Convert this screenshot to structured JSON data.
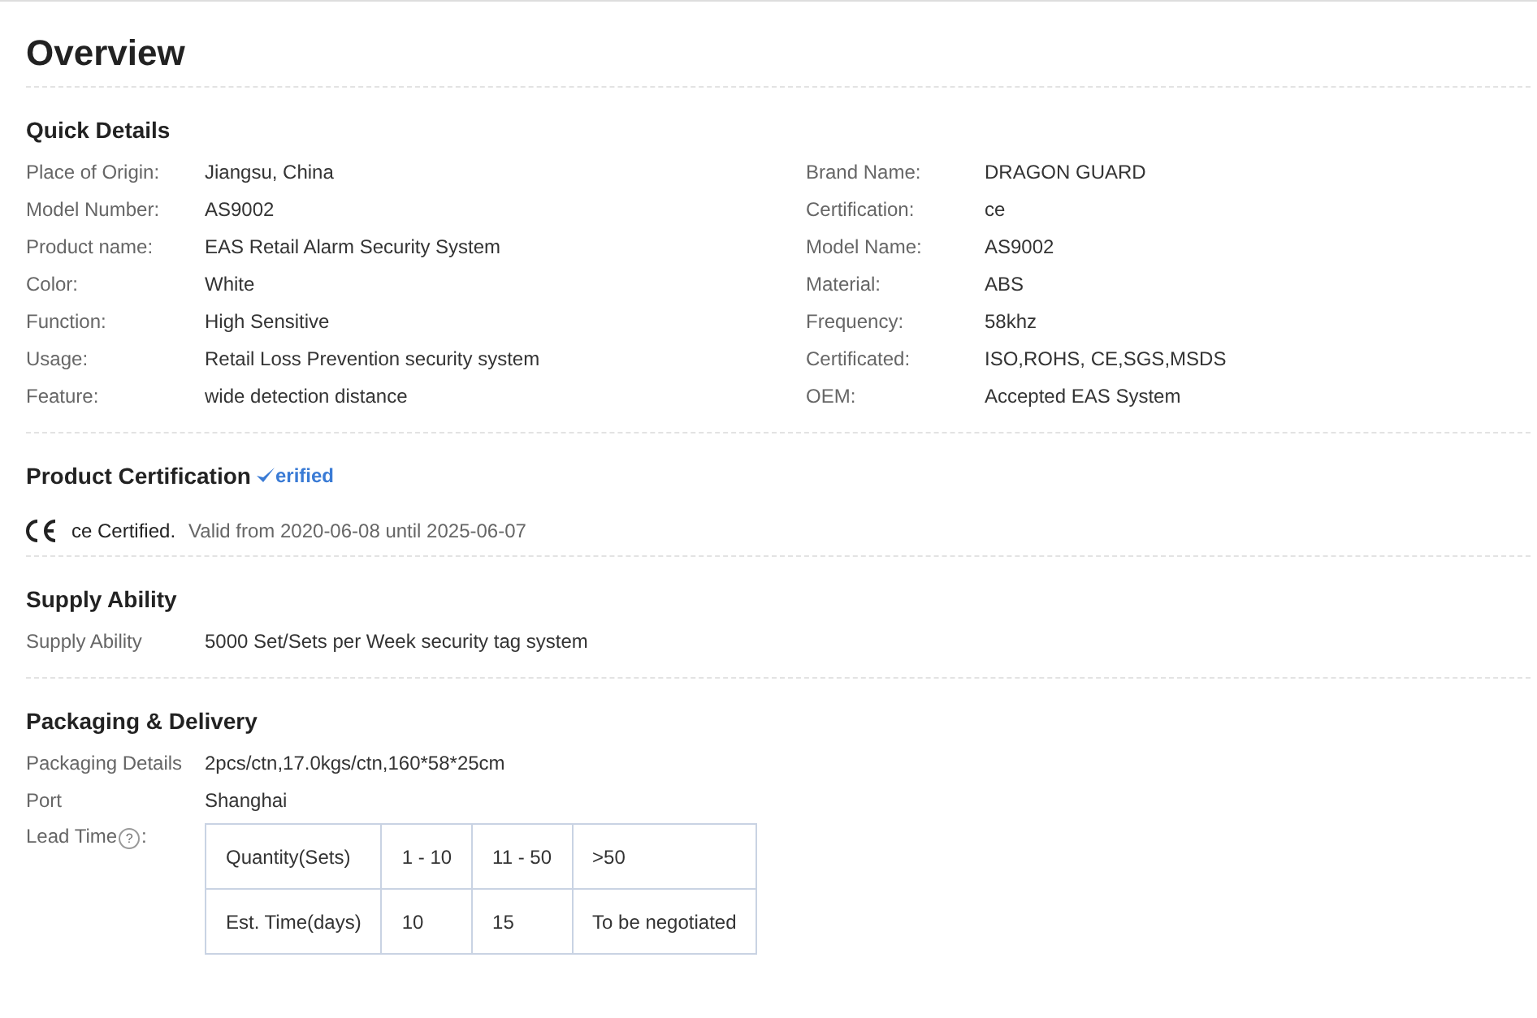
{
  "title": "Overview",
  "quick_details": {
    "heading": "Quick Details",
    "rows": [
      {
        "left_label": "Place of Origin:",
        "left_value": "Jiangsu, China",
        "right_label": "Brand Name:",
        "right_value": "DRAGON GUARD"
      },
      {
        "left_label": "Model Number:",
        "left_value": "AS9002",
        "right_label": "Certification:",
        "right_value": "ce"
      },
      {
        "left_label": "Product name:",
        "left_value": "EAS Retail Alarm Security System",
        "right_label": "Model Name:",
        "right_value": "AS9002"
      },
      {
        "left_label": "Color:",
        "left_value": "White",
        "right_label": "Material:",
        "right_value": "ABS"
      },
      {
        "left_label": "Function:",
        "left_value": "High Sensitive",
        "right_label": "Frequency:",
        "right_value": "58khz"
      },
      {
        "left_label": "Usage:",
        "left_value": "Retail Loss Prevention security system",
        "right_label": "Certificated:",
        "right_value": "ISO,ROHS, CE,SGS,MSDS"
      },
      {
        "left_label": "Feature:",
        "left_value": "wide detection distance",
        "right_label": "OEM:",
        "right_value": "Accepted EAS System"
      }
    ]
  },
  "certification": {
    "heading": "Product Certification",
    "badge": "erified",
    "name": "ce Certified.",
    "validity": "Valid from 2020-06-08 until 2025-06-07"
  },
  "supply": {
    "heading": "Supply Ability",
    "rows": [
      {
        "label": "Supply Ability",
        "value": "5000 Set/Sets per Week security tag system"
      }
    ]
  },
  "packaging": {
    "heading": "Packaging & Delivery",
    "rows": [
      {
        "label": "Packaging Details",
        "value": "2pcs/ctn,17.0kgs/ctn,160*58*25cm"
      },
      {
        "label": "Port",
        "value": "Shanghai"
      }
    ],
    "lead_time": {
      "label": "Lead Time",
      "help": "?",
      "suffix": ":",
      "table": [
        [
          "Quantity(Sets)",
          "1 - 10",
          "11 - 50",
          ">50"
        ],
        [
          "Est. Time(days)",
          "10",
          "15",
          "To be negotiated"
        ]
      ]
    }
  }
}
